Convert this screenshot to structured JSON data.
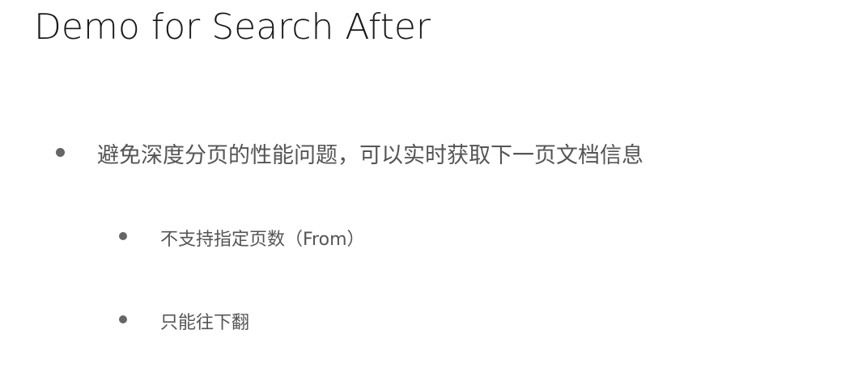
{
  "title": "Demo for Search After",
  "bullets": [
    {
      "text": "避免深度分页的性能问题，可以实时获取下一页文档信息",
      "level": 1
    },
    {
      "text": "不支持指定页数（From）",
      "level": 2
    },
    {
      "text": "只能往下翻",
      "level": 2
    }
  ]
}
